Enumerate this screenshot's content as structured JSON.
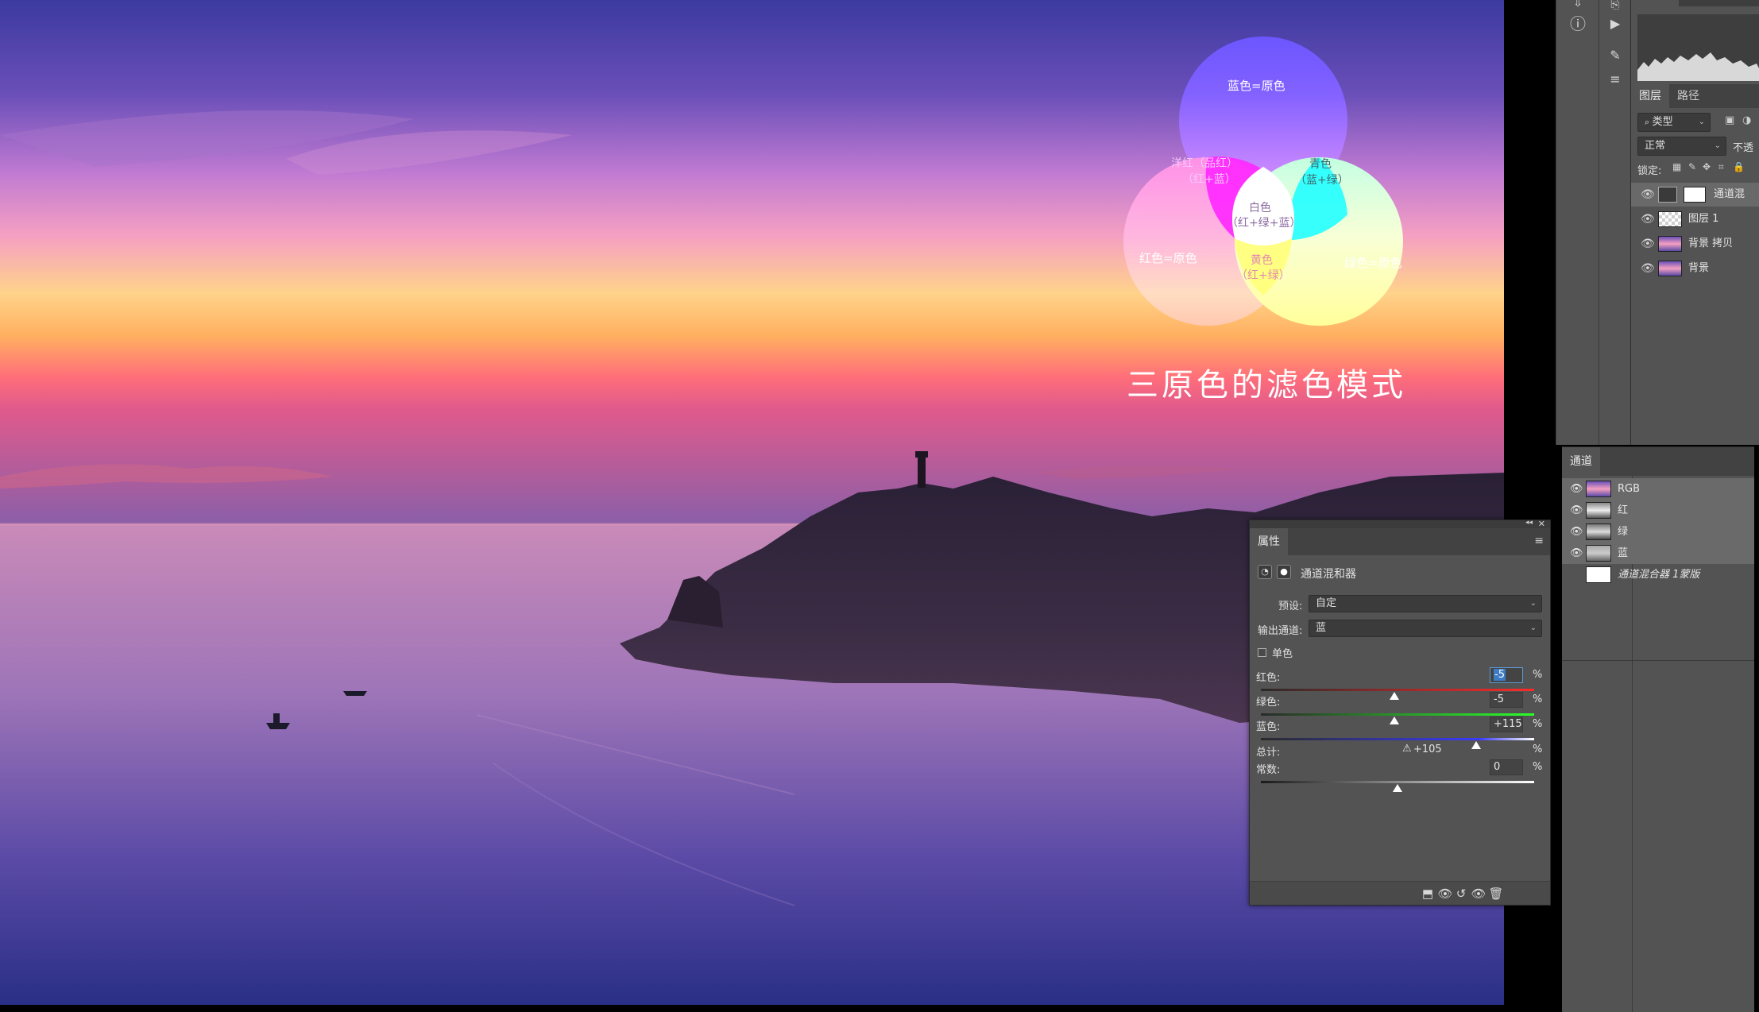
{
  "venn": {
    "blue": "蓝色=原色",
    "red": "红色=原色",
    "green": "绿色=原色",
    "magenta_1": "洋红（品红）",
    "magenta_2": "（红+蓝）",
    "cyan_1": "青色",
    "cyan_2": "（蓝+绿）",
    "yellow_1": "黄色",
    "yellow_2": "（红+绿）",
    "white_1": "白色",
    "white_2": "（红+绿+蓝）",
    "caption": "三原色的滤色模式"
  },
  "layers_panel": {
    "tabs": [
      "图层",
      "路径"
    ],
    "filter_kind": "类型",
    "blend_mode": "正常",
    "opacity_label": "不透",
    "lock_label": "锁定:",
    "layers": [
      {
        "name": "通道混",
        "type": "adjustment"
      },
      {
        "name": "图层 1",
        "type": "transparent"
      },
      {
        "name": "背景 拷贝",
        "type": "photo"
      },
      {
        "name": "背景",
        "type": "photo"
      }
    ]
  },
  "channels_panel": {
    "tab": "通道",
    "channels": [
      {
        "name": "RGB"
      },
      {
        "name": "红"
      },
      {
        "name": "绿"
      },
      {
        "name": "蓝"
      },
      {
        "name": "通道混合器 1蒙版"
      }
    ]
  },
  "properties": {
    "tab": "属性",
    "adjustment_name": "通道混和器",
    "preset_label": "预设:",
    "preset_value": "自定",
    "output_label": "输出通道:",
    "output_value": "蓝",
    "monochrome_label": "单色",
    "monochrome_checked": false,
    "red_label": "红色:",
    "red_value": "-5",
    "green_label": "绿色:",
    "green_value": "-5",
    "blue_label": "蓝色:",
    "blue_value": "+115",
    "total_label": "总计:",
    "total_value": "+105",
    "constant_label": "常数:",
    "constant_value": "0",
    "percent": "%",
    "slider_levels": {
      "red": -5,
      "green": -5,
      "blue": 115,
      "constant": 0
    },
    "slider_range": [
      -200,
      200
    ]
  },
  "icons": {
    "warning": "warning-icon",
    "eye": "eye-icon",
    "menu": "panel-menu-icon"
  }
}
